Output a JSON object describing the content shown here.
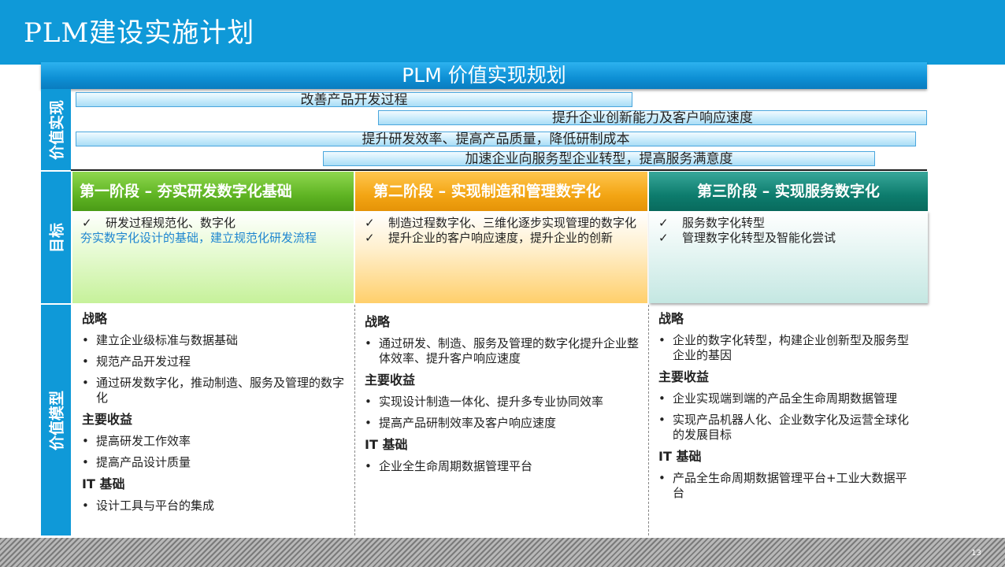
{
  "header": {
    "title": "PLM建设实施计划"
  },
  "plan_title": "PLM 价值实现规划",
  "side_labels": {
    "value": "价值实现",
    "goal": "目标",
    "model": "价值模型"
  },
  "value_bars": [
    "改善产品开发过程",
    "提升企业创新能力及客户响应速度",
    "提升研发效率、提高产品质量，降低研制成本",
    "加速企业向服务型企业转型，提高服务满意度"
  ],
  "check_mark": "✓",
  "bullet": "•",
  "phases": [
    {
      "title": "第一阶段 – 夯实研发数字化基础",
      "checks": [
        "研发过程规范化、数字化"
      ],
      "note": "夯实数字化设计的基础，建立规范化研发流程"
    },
    {
      "title": "第二阶段 – 实现制造和管理数字化",
      "checks": [
        "制造过程数字化、三维化逐步实现管理的数字化",
        "提升企业的客户响应速度，提升企业的创新"
      ]
    },
    {
      "title": "第三阶段  –  实现服务数字化",
      "checks": [
        "服务数字化转型",
        "管理数字化转型及智能化尝试"
      ]
    }
  ],
  "model": [
    {
      "strategy_label": "战略",
      "strategy": [
        "建立企业级标准与数据基础",
        "规范产品开发过程",
        "通过研发数字化，推动制造、服务及管理的数字化"
      ],
      "benefit_label": "主要收益",
      "benefits": [
        "提高研发工作效率",
        "提高产品设计质量"
      ],
      "it_label": "IT 基础",
      "it": [
        "设计工具与平台的集成"
      ]
    },
    {
      "strategy_label": "战略",
      "strategy": [
        "通过研发、制造、服务及管理的数字化提升企业整体效率、提升客户响应速度"
      ],
      "benefit_label": "主要收益",
      "benefits": [
        "实现设计制造一体化、提升多专业协同效率",
        "提高产品研制效率及客户响应速度"
      ],
      "it_label": "IT 基础",
      "it": [
        "企业全生命周期数据管理平台"
      ]
    },
    {
      "strategy_label": "战略",
      "strategy": [
        "企业的数字化转型，构建企业创新型及服务型企业的基因"
      ],
      "benefit_label": "主要收益",
      "benefits": [
        "企业实现端到端的产品全生命周期数据管理",
        "实现产品机器人化、企业数字化及运营全球化的发展目标"
      ],
      "it_label": "IT 基础",
      "it": [
        "产品全生命周期数据管理平台+工业大数据平台"
      ]
    }
  ],
  "page_number": "13"
}
